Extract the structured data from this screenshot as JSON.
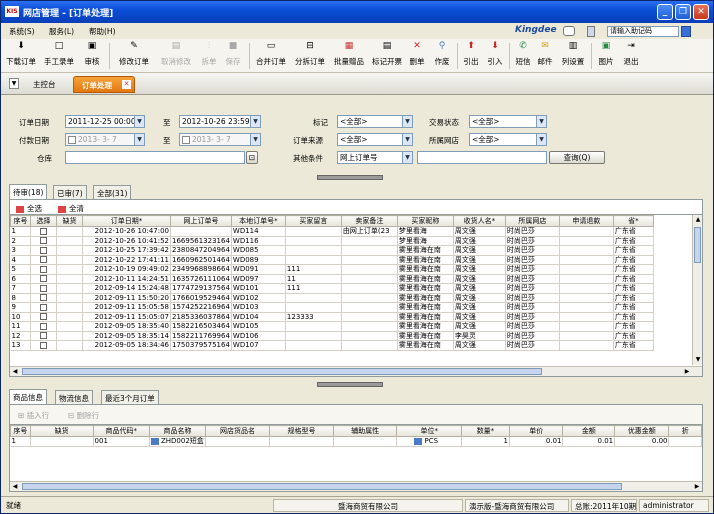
{
  "window": {
    "app_icon": "KIS",
    "title": "网店管理 - [订单处理]",
    "buttons": [
      "_",
      "❐",
      "✕"
    ]
  },
  "menu": [
    "系统(S)",
    "服务(L)",
    "帮助(H)"
  ],
  "brand": {
    "logo": "Kingdee",
    "help_text": "请输入助记码"
  },
  "toolbar": [
    {
      "label": "下载订单",
      "icon": "download-icon",
      "enabled": true
    },
    {
      "label": "手工录单",
      "icon": "new-document-icon",
      "enabled": true
    },
    {
      "label": "审核",
      "icon": "audit-icon",
      "enabled": true
    },
    {
      "label": "修改订单",
      "icon": "pencil-icon",
      "enabled": true
    },
    {
      "label": "取消修改",
      "icon": "cancel-edit-icon",
      "enabled": false
    },
    {
      "label": "拆单",
      "icon": "split-icon",
      "enabled": false
    },
    {
      "label": "保存",
      "icon": "save-icon",
      "enabled": false
    },
    {
      "label": "合并订单",
      "icon": "merge-icon",
      "enabled": true
    },
    {
      "label": "分拆订单",
      "icon": "split-order-icon",
      "enabled": true
    },
    {
      "label": "批量赠品",
      "icon": "gift-icon",
      "enabled": true
    },
    {
      "label": "标记开票",
      "icon": "invoice-icon",
      "enabled": true
    },
    {
      "label": "删单",
      "icon": "delete-icon",
      "enabled": true
    },
    {
      "label": "作废",
      "icon": "void-icon",
      "enabled": true
    },
    {
      "label": "引出",
      "icon": "export-icon",
      "enabled": true
    },
    {
      "label": "引入",
      "icon": "import-icon",
      "enabled": true
    },
    {
      "label": "短信",
      "icon": "sms-icon",
      "enabled": true
    },
    {
      "label": "邮件",
      "icon": "mail-icon",
      "enabled": true
    },
    {
      "label": "列设置",
      "icon": "column-settings-icon",
      "enabled": true
    },
    {
      "label": "图片",
      "icon": "picture-icon",
      "enabled": true
    },
    {
      "label": "退出",
      "icon": "exit-icon",
      "enabled": true
    }
  ],
  "tabs": {
    "home": "主控台",
    "document": "订单处理"
  },
  "filter": {
    "order_date_label": "订单日期",
    "order_date_from": "2011-12-25 00:00",
    "order_date_to": "2012-10-26 23:59",
    "to_label": "至",
    "pay_date_label": "付款日期",
    "pay_date_from": "2013- 3- 7",
    "pay_date_to": "2013- 3- 7",
    "warehouse_label": "仓库",
    "warehouse_value": "",
    "mark_label": "标记",
    "mark_value": "<全部>",
    "source_label": "订单来源",
    "source_value": "<全部>",
    "other_label": "其他条件",
    "other_value": "网上订单号",
    "other_input": "",
    "trade_status_label": "交易状态",
    "trade_status_value": "<全部>",
    "shop_label": "所属网店",
    "shop_value": "<全部>",
    "query_button": "查询(Q)"
  },
  "grid_tabs": [
    "待审(18)",
    "已审(7)",
    "全部(31)"
  ],
  "selection": {
    "select_all": "全选",
    "clear_all": "全清"
  },
  "orders_columns": [
    "序号",
    "选择",
    "缺货",
    "订单日期*",
    "网上订单号",
    "本地订单号*",
    "买家留言",
    "卖家备注",
    "买家昵称",
    "收货人名*",
    "所属网店",
    "申请退款",
    "省*"
  ],
  "orders": [
    {
      "no": "1",
      "date": "2012-10-26",
      "time": "10:47:00",
      "online": "",
      "local": "WD114",
      "buyer_msg": "",
      "seller_note": "由网上订单(23",
      "nick": "梦里看海",
      "receiver": "周文强",
      "shop": "时尚巴莎",
      "refund": "",
      "province": "广东省"
    },
    {
      "no": "2",
      "date": "2012-10-26",
      "time": "10:41:52",
      "online": "1669561323164",
      "local": "WD116",
      "buyer_msg": "",
      "seller_note": "",
      "nick": "梦里看海",
      "receiver": "周文强",
      "shop": "时尚巴莎",
      "refund": "",
      "province": "广东省"
    },
    {
      "no": "3",
      "date": "2012-10-25",
      "time": "17:39:42",
      "online": "2380847204964",
      "local": "WD085",
      "buyer_msg": "",
      "seller_note": "",
      "nick": "雾里看海在南",
      "receiver": "周文强",
      "shop": "时尚巴莎",
      "refund": "",
      "province": "广东省"
    },
    {
      "no": "4",
      "date": "2012-10-22",
      "time": "17:41:11",
      "online": "1660962501464",
      "local": "WD089",
      "buyer_msg": "",
      "seller_note": "",
      "nick": "雾里看海在南",
      "receiver": "周文强",
      "shop": "时尚巴莎",
      "refund": "",
      "province": "广东省"
    },
    {
      "no": "5",
      "date": "2012-10-19",
      "time": "09:49:02",
      "online": "2349968898664",
      "local": "WD091",
      "buyer_msg": "111",
      "seller_note": "",
      "nick": "雾里看海在南",
      "receiver": "周文强",
      "shop": "时尚巴莎",
      "refund": "",
      "province": "广东省"
    },
    {
      "no": "6",
      "date": "2012-10-11",
      "time": "14:24:51",
      "online": "1635726111064",
      "local": "WD097",
      "buyer_msg": "11",
      "seller_note": "",
      "nick": "雾里看海在南",
      "receiver": "周文强",
      "shop": "时尚巴莎",
      "refund": "",
      "province": "广东省"
    },
    {
      "no": "7",
      "date": "2012-09-14",
      "time": "15:24:48",
      "online": "1774729137564",
      "local": "WD101",
      "buyer_msg": "111",
      "seller_note": "",
      "nick": "雾里看海在南",
      "receiver": "周文强",
      "shop": "时尚巴莎",
      "refund": "",
      "province": "广东省"
    },
    {
      "no": "8",
      "date": "2012-09-11",
      "time": "15:50:20",
      "online": "1766019529464",
      "local": "WD102",
      "buyer_msg": "",
      "seller_note": "",
      "nick": "雾里看海在南",
      "receiver": "周文强",
      "shop": "时尚巴莎",
      "refund": "",
      "province": "广东省"
    },
    {
      "no": "9",
      "date": "2012-09-11",
      "time": "15:05:58",
      "online": "1574252216964",
      "local": "WD103",
      "buyer_msg": "",
      "seller_note": "",
      "nick": "雾里看海在南",
      "receiver": "周文强",
      "shop": "时尚巴莎",
      "refund": "",
      "province": "广东省"
    },
    {
      "no": "10",
      "date": "2012-09-11",
      "time": "15:05:07",
      "online": "2185336037864",
      "local": "WD104",
      "buyer_msg": "123333",
      "seller_note": "",
      "nick": "雾里看海在南",
      "receiver": "周文强",
      "shop": "时尚巴莎",
      "refund": "",
      "province": "广东省"
    },
    {
      "no": "11",
      "date": "2012-09-05",
      "time": "18:35:40",
      "online": "1582216503464",
      "local": "WD105",
      "buyer_msg": "",
      "seller_note": "",
      "nick": "雾里看海在南",
      "receiver": "周文强",
      "shop": "时尚巴莎",
      "refund": "",
      "province": "广东省"
    },
    {
      "no": "12",
      "date": "2012-09-05",
      "time": "18:35:14",
      "online": "1582211769964",
      "local": "WD106",
      "buyer_msg": "",
      "seller_note": "",
      "nick": "雾里看海在南",
      "receiver": "李昊灵",
      "shop": "时尚巴莎",
      "refund": "",
      "province": "广东省"
    },
    {
      "no": "13",
      "date": "2012-09-05",
      "time": "18:34:46",
      "online": "1750379575164",
      "local": "WD107",
      "buyer_msg": "",
      "seller_note": "",
      "nick": "雾里看海在南",
      "receiver": "周文强",
      "shop": "时尚巴莎",
      "refund": "",
      "province": "广东省"
    }
  ],
  "bottom_tabs": [
    "商品信息",
    "物流信息",
    "最近3个月订单"
  ],
  "bottom_toolbar": {
    "insert": "插入行",
    "delete": "删除行"
  },
  "items_columns": [
    "序号",
    "缺货",
    "商品代码*",
    "商品名称",
    "网店货品名",
    "规格型号",
    "辅助属性",
    "单位*",
    "数量*",
    "单价",
    "金额",
    "优惠金额",
    "折"
  ],
  "items": [
    {
      "no": "1",
      "code": "001",
      "name": "ZHD002短盒",
      "shop_name": "",
      "spec": "",
      "aux": "",
      "unit": "PCS",
      "qty": "1",
      "price": "0.01",
      "amount": "0.01",
      "discount": "0.00"
    }
  ],
  "status": {
    "ready": "就绪",
    "company": "暨海商贸有限公司",
    "demo": "演示版-暨海商贸有限公司",
    "period": "总账:2011年10期",
    "user": "administrator"
  }
}
